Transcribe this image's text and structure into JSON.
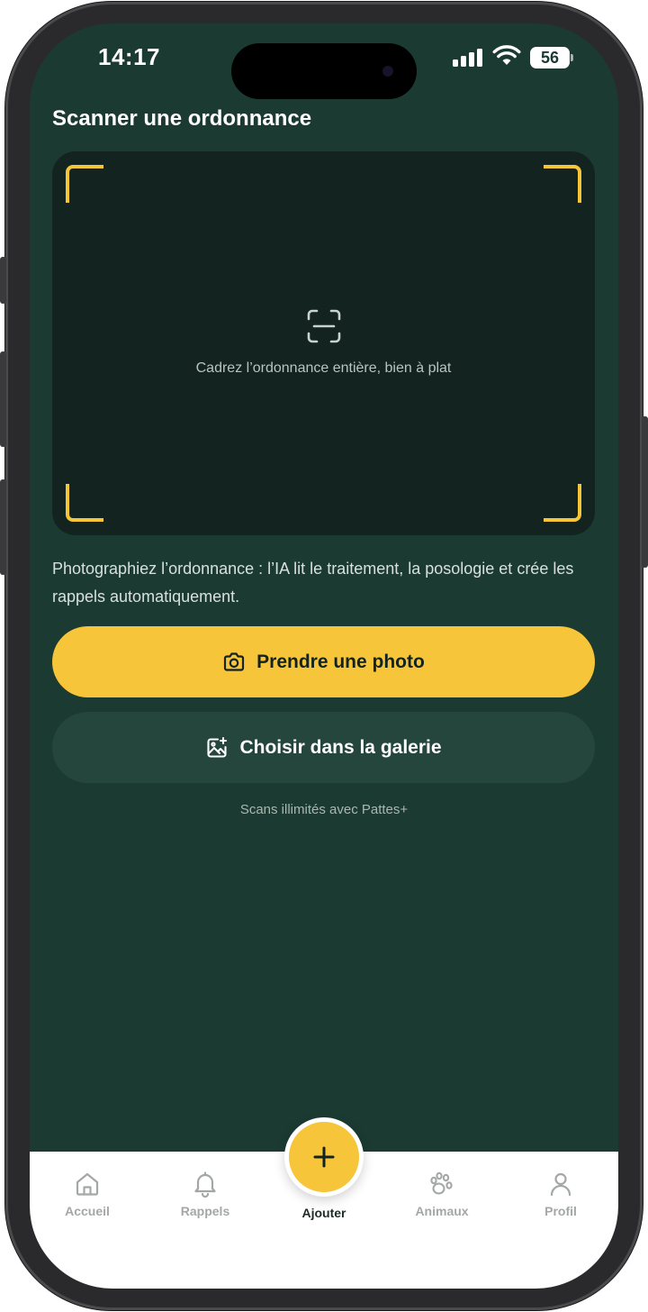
{
  "status_bar": {
    "time": "14:17",
    "battery": "56"
  },
  "page": {
    "title": "Scanner une ordonnance"
  },
  "scanner": {
    "hint": "Cadrez l’ordonnance entière, bien à plat"
  },
  "description": "Photographiez l’ordonnance : l’IA lit le traitement, la posologie et crée les rappels automatiquement.",
  "actions": {
    "take_photo": "Prendre une photo",
    "choose_gallery": "Choisir dans la galerie"
  },
  "upsell": "Scans illimités avec Pattes+",
  "tabs": [
    {
      "label": "Accueil",
      "icon": "home-icon"
    },
    {
      "label": "Rappels",
      "icon": "bell-icon"
    },
    {
      "label": "Ajouter",
      "icon": "plus-icon"
    },
    {
      "label": "Animaux",
      "icon": "paw-icon"
    },
    {
      "label": "Profil",
      "icon": "user-icon"
    }
  ],
  "colors": {
    "background": "#1b3a32",
    "accent": "#f7c53a",
    "scan_area": "#13231f",
    "secondary_button": "#24463c"
  }
}
